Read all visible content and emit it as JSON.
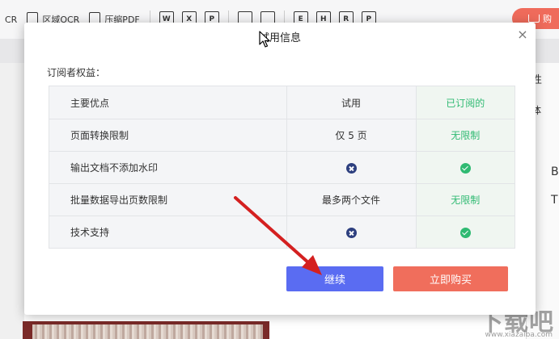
{
  "toolbar": {
    "items": [
      {
        "label": "CR",
        "icon": "ocr-icon"
      },
      {
        "label": "区域OCR",
        "icon": "region-ocr-icon"
      },
      {
        "label": "压缩PDF",
        "icon": "compress-pdf-icon"
      }
    ],
    "format_icons": [
      "W",
      "X",
      "P"
    ],
    "format_icons_b": [
      "",
      ""
    ],
    "format_icons_c": [
      "E",
      "H",
      "R",
      "P"
    ],
    "buy_label": "购"
  },
  "right_panel": {
    "t1": "性",
    "t2": "体",
    "t3": "B",
    "t4": "T"
  },
  "dialog": {
    "title": "试用信息",
    "close": "×",
    "section_label": "订阅者权益：",
    "table": {
      "headers": [
        "主要优点",
        "试用",
        "已订阅的"
      ],
      "rows": [
        {
          "feature": "页面转换限制",
          "trial": "仅 5 页",
          "subscribed": "无限制"
        },
        {
          "feature": "输出文档不添加水印",
          "trial": "no",
          "subscribed": "yes"
        },
        {
          "feature": "批量数据导出页数限制",
          "trial": "最多两个文件",
          "subscribed": "无限制"
        },
        {
          "feature": "技术支持",
          "trial": "no",
          "subscribed": "yes"
        }
      ]
    },
    "continue_label": "继续",
    "buy_now_label": "立即购买"
  },
  "watermark": {
    "text": "下载吧",
    "url": "www.xiazaiba.com"
  },
  "colors": {
    "primary": "#5a6cf2",
    "buy": "#f06e5c",
    "green": "#2fba72",
    "cross": "#2d3f7f",
    "arrow": "#d42020"
  }
}
